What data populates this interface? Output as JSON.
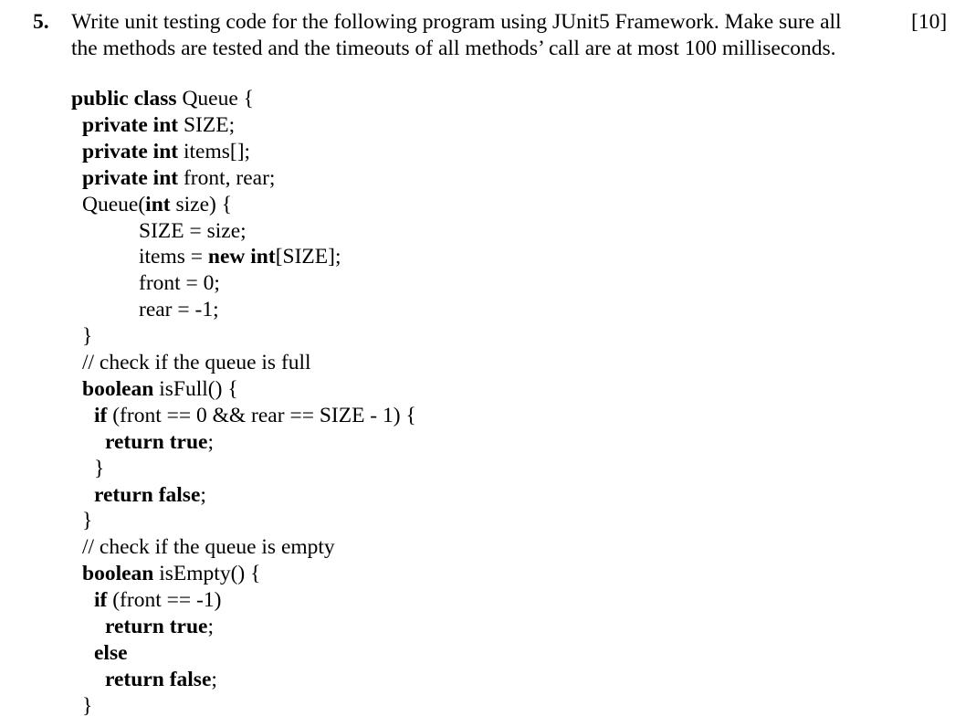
{
  "question": {
    "number": "5.",
    "lines": [
      "Write unit testing code for the following program using JUnit5 Framework. Make sure all",
      "the methods are tested and the timeouts of all methods’ call are at most 100 milliseconds."
    ],
    "marks": "[10]"
  },
  "code": {
    "lines": [
      {
        "indent": 0,
        "segments": [
          {
            "t": "public class",
            "b": true
          },
          {
            "t": " Queue {",
            "b": false
          }
        ]
      },
      {
        "indent": 1,
        "segments": [
          {
            "t": "private int",
            "b": true
          },
          {
            "t": " SIZE;",
            "b": false
          }
        ]
      },
      {
        "indent": 1,
        "segments": [
          {
            "t": "private int",
            "b": true
          },
          {
            "t": " items[];",
            "b": false
          }
        ]
      },
      {
        "indent": 1,
        "segments": [
          {
            "t": "private int",
            "b": true
          },
          {
            "t": " front, rear;",
            "b": false
          }
        ]
      },
      {
        "indent": 1,
        "segments": [
          {
            "t": "Queue(",
            "b": false
          },
          {
            "t": "int",
            "b": true
          },
          {
            "t": " size) {",
            "b": false
          }
        ]
      },
      {
        "indent": 6,
        "segments": [
          {
            "t": "SIZE = size;",
            "b": false
          }
        ]
      },
      {
        "indent": 6,
        "segments": [
          {
            "t": "items = ",
            "b": false
          },
          {
            "t": "new int",
            "b": true
          },
          {
            "t": "[SIZE];",
            "b": false
          }
        ]
      },
      {
        "indent": 6,
        "segments": [
          {
            "t": "front = 0;",
            "b": false
          }
        ]
      },
      {
        "indent": 6,
        "segments": [
          {
            "t": "rear = -1;",
            "b": false
          }
        ]
      },
      {
        "indent": 1,
        "segments": [
          {
            "t": "}",
            "b": false
          }
        ]
      },
      {
        "indent": 1,
        "segments": [
          {
            "t": "// check if the queue is full",
            "b": false
          }
        ]
      },
      {
        "indent": 1,
        "segments": [
          {
            "t": "boolean",
            "b": true
          },
          {
            "t": " isFull() {",
            "b": false
          }
        ]
      },
      {
        "indent": 2,
        "segments": [
          {
            "t": "if",
            "b": true
          },
          {
            "t": " (front == 0 && rear == SIZE - 1) {",
            "b": false
          }
        ]
      },
      {
        "indent": 3,
        "segments": [
          {
            "t": "return true",
            "b": true
          },
          {
            "t": ";",
            "b": false
          }
        ]
      },
      {
        "indent": 2,
        "segments": [
          {
            "t": "}",
            "b": false
          }
        ]
      },
      {
        "indent": 2,
        "segments": [
          {
            "t": "return false",
            "b": true
          },
          {
            "t": ";",
            "b": false
          }
        ]
      },
      {
        "indent": 1,
        "segments": [
          {
            "t": "}",
            "b": false
          }
        ]
      },
      {
        "indent": 1,
        "segments": [
          {
            "t": "// check if the queue is empty",
            "b": false
          }
        ]
      },
      {
        "indent": 1,
        "segments": [
          {
            "t": "boolean",
            "b": true
          },
          {
            "t": " isEmpty() {",
            "b": false
          }
        ]
      },
      {
        "indent": 2,
        "segments": [
          {
            "t": "if",
            "b": true
          },
          {
            "t": " (front == -1)",
            "b": false
          }
        ]
      },
      {
        "indent": 3,
        "segments": [
          {
            "t": "return true",
            "b": true
          },
          {
            "t": ";",
            "b": false
          }
        ]
      },
      {
        "indent": 2,
        "segments": [
          {
            "t": "else",
            "b": true
          }
        ]
      },
      {
        "indent": 3,
        "segments": [
          {
            "t": "return false",
            "b": true
          },
          {
            "t": ";",
            "b": false
          }
        ]
      },
      {
        "indent": 1,
        "segments": [
          {
            "t": "}",
            "b": false
          }
        ]
      }
    ]
  }
}
